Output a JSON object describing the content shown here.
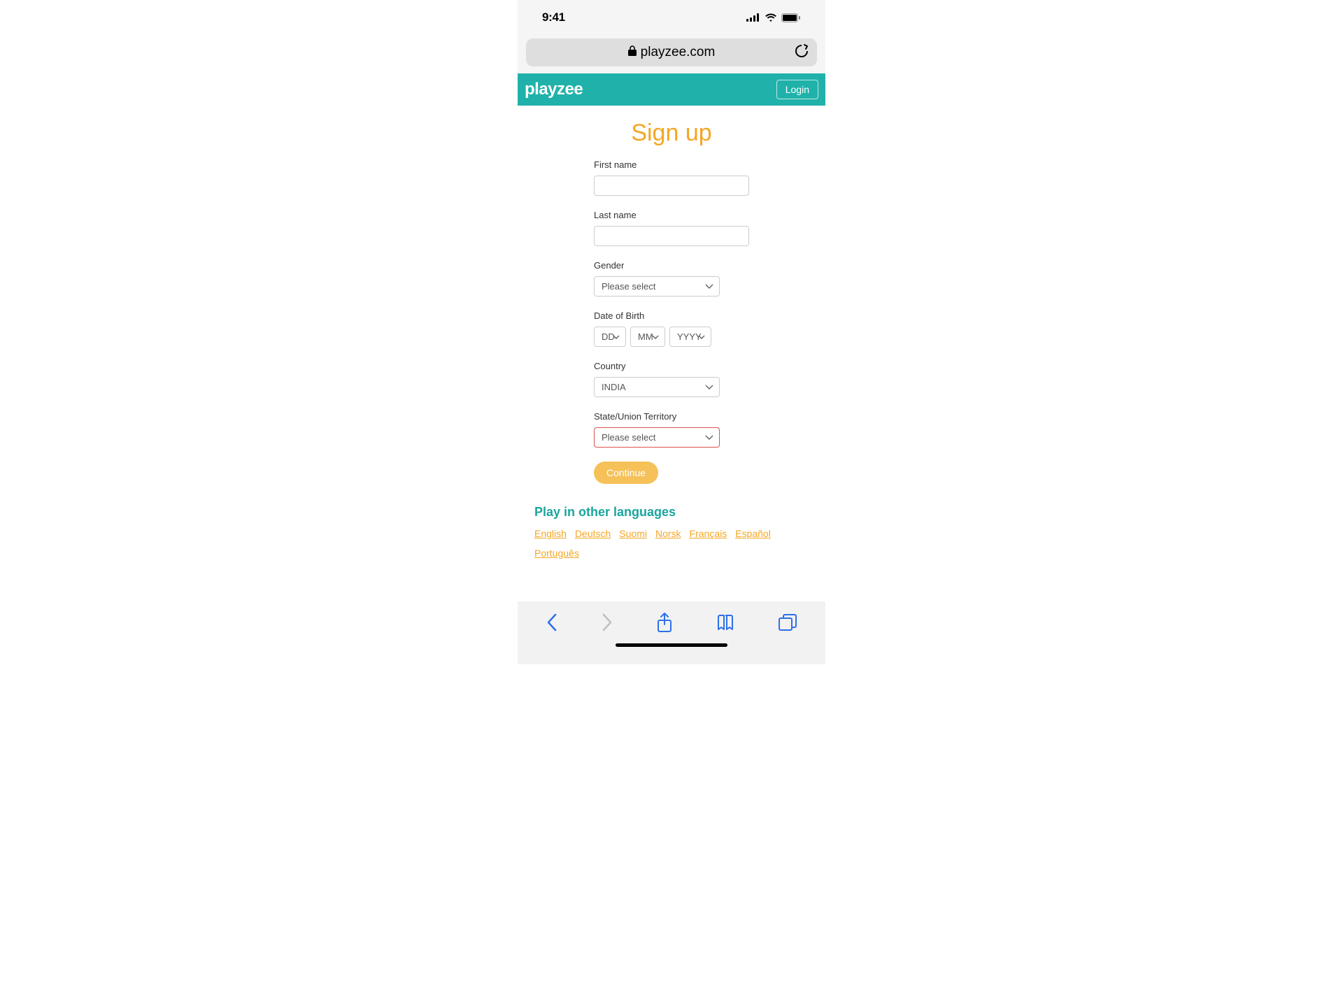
{
  "status": {
    "time": "9:41"
  },
  "urlBar": {
    "domain": "playzee.com"
  },
  "header": {
    "logo": "playzee",
    "login": "Login"
  },
  "signup": {
    "title": "Sign up",
    "firstNameLabel": "First name",
    "lastNameLabel": "Last name",
    "genderLabel": "Gender",
    "genderValue": "Please select",
    "dobLabel": "Date of Birth",
    "dobDD": "DD",
    "dobMM": "MM",
    "dobYYYY": "YYYY",
    "countryLabel": "Country",
    "countryValue": "INDIA",
    "stateLabel": "State/Union Territory",
    "stateValue": "Please select",
    "continue": "Continue"
  },
  "languages": {
    "title": "Play in other languages",
    "items": [
      "English",
      "Deutsch",
      "Suomi",
      "Norsk",
      "Français",
      "Español",
      "Português"
    ]
  }
}
